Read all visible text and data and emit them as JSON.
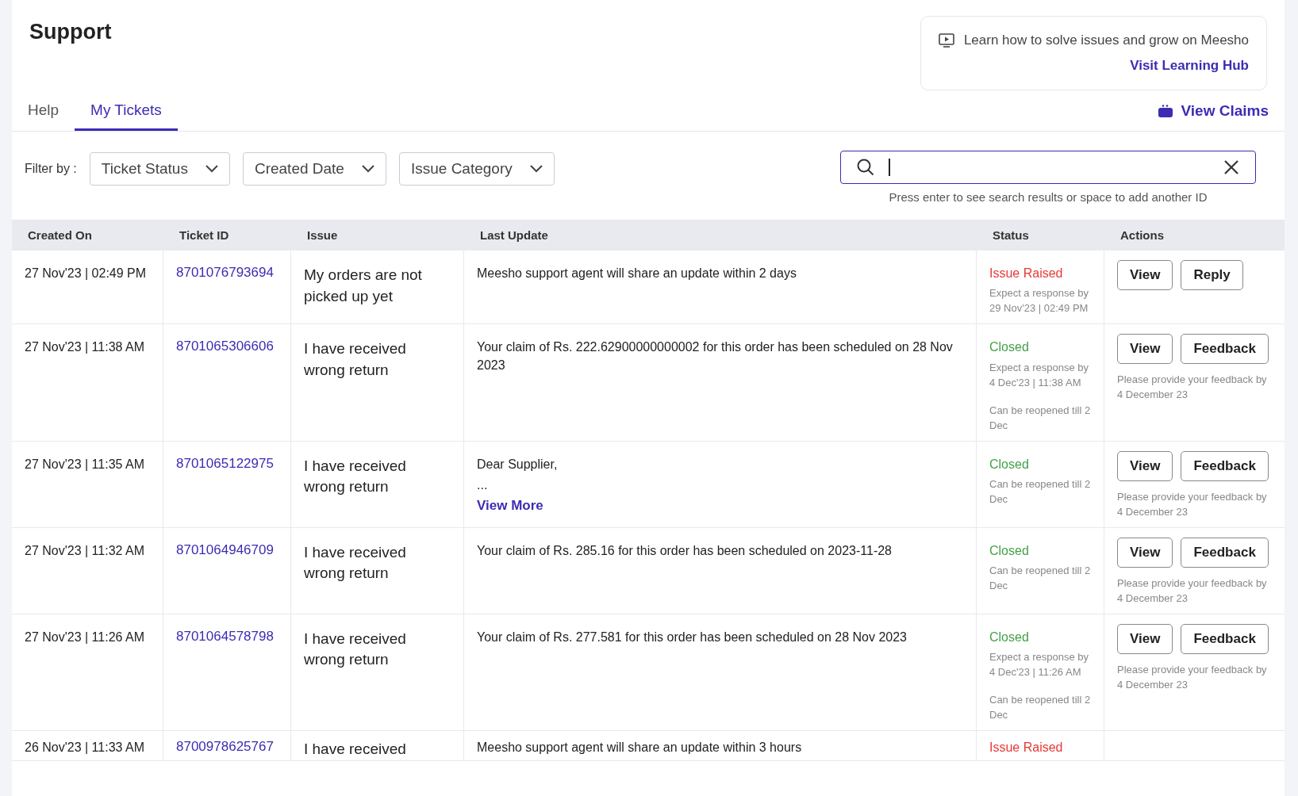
{
  "page": {
    "title": "Support"
  },
  "learning_card": {
    "text": "Learn how to solve issues and grow on Meesho",
    "link": "Visit Learning Hub"
  },
  "tabs": [
    {
      "label": "Help",
      "selected": false
    },
    {
      "label": "My Tickets",
      "selected": true
    }
  ],
  "view_claims": "View Claims",
  "filters": {
    "label": "Filter by :",
    "dropdowns": [
      "Ticket Status",
      "Created Date",
      "Issue Category"
    ]
  },
  "search": {
    "hint": "Press enter to see search results or space to add another ID"
  },
  "table": {
    "columns": [
      "Created On",
      "Ticket ID",
      "Issue",
      "Last Update",
      "Status",
      "Actions"
    ],
    "rows": [
      {
        "created": "27 Nov'23 | 02:49 PM",
        "ticket_id": "8701076793694",
        "issue": "My orders are not picked up yet",
        "update": [
          "Meesho support agent will share an update within 2 days"
        ],
        "status": {
          "label": "Issue Raised",
          "kind": "raised"
        },
        "notes": [
          "Expect a response by 29 Nov'23 | 02:49 PM"
        ],
        "actions": [
          "View",
          "Reply"
        ]
      },
      {
        "created": "27 Nov'23 | 11:38 AM",
        "ticket_id": "8701065306606",
        "issue": "I have received wrong return",
        "update": [
          "Your claim of Rs. 222.62900000000002 for this order has been scheduled on 28 Nov 2023"
        ],
        "status": {
          "label": "Closed",
          "kind": "closed"
        },
        "notes": [
          "Expect a response by 4 Dec'23 | 11:38 AM",
          "Can be reopened till 2 Dec"
        ],
        "actions": [
          "View",
          "Feedback"
        ],
        "feedback_note": "Please provide your feedback by 4 December 23"
      },
      {
        "created": "27 Nov'23 | 11:35 AM",
        "ticket_id": "8701065122975",
        "issue": "I have received wrong return",
        "update": [
          "Dear Supplier,",
          "..."
        ],
        "update_link": "View More",
        "status": {
          "label": "Closed",
          "kind": "closed"
        },
        "notes": [
          "Can be reopened till 2 Dec"
        ],
        "actions": [
          "View",
          "Feedback"
        ],
        "feedback_note": "Please provide your feedback by 4 December 23"
      },
      {
        "created": "27 Nov'23 | 11:32 AM",
        "ticket_id": "8701064946709",
        "issue": "I have received wrong return",
        "update": [
          "Your claim of Rs. 285.16 for this order has been scheduled on 2023-11-28"
        ],
        "status": {
          "label": "Closed",
          "kind": "closed"
        },
        "notes": [
          "Can be reopened till 2 Dec"
        ],
        "actions": [
          "View",
          "Feedback"
        ],
        "feedback_note": "Please provide your feedback by 4 December 23"
      },
      {
        "created": "27 Nov'23 | 11:26 AM",
        "ticket_id": "8701064578798",
        "issue": "I have received wrong return",
        "update": [
          "Your claim of Rs. 277.581 for this order has been scheduled on 28 Nov 2023"
        ],
        "status": {
          "label": "Closed",
          "kind": "closed"
        },
        "notes": [
          "Expect a response by 4 Dec'23 | 11:26 AM",
          "Can be reopened till 2 Dec"
        ],
        "actions": [
          "View",
          "Feedback"
        ],
        "feedback_note": "Please provide your feedback by 4 December 23"
      },
      {
        "created": "26 Nov'23 | 11:33 AM",
        "ticket_id": "8700978625767",
        "issue": "I have received",
        "update": [
          "Meesho support agent will share an update within 3 hours"
        ],
        "status": {
          "label": "Issue Raised",
          "kind": "raised"
        },
        "notes": [],
        "actions": []
      }
    ]
  }
}
